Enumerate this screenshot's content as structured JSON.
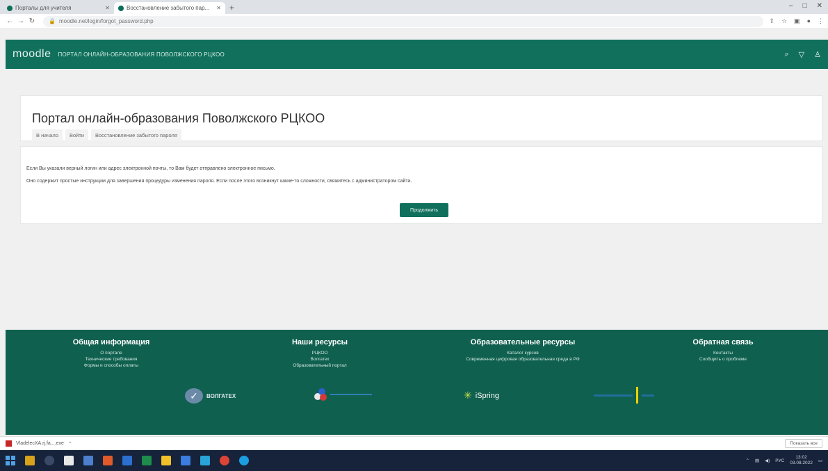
{
  "browser": {
    "tabs": [
      {
        "title": "Порталы для учителя"
      },
      {
        "title": "Восстановление забытого пар..."
      }
    ],
    "new_tab": "+",
    "url": "moodle.net/login/forgot_password.php",
    "window_controls": {
      "minimize": "–",
      "maximize": "□",
      "close": "✕"
    }
  },
  "site": {
    "logo": "moodle",
    "portal_name": "ПОРТАЛ ОНЛАЙН-ОБРАЗОВАНИЯ ПОВОЛЖСКОГО РЦКОО"
  },
  "page": {
    "title": "Портал онлайн-образования Поволжского РЦКОО",
    "breadcrumb": [
      "В начало",
      "Войти",
      "Восстановление забытого пароля"
    ]
  },
  "content": {
    "message1": "Если Вы указали верный логин или адрес электронной почты, то Вам будет отправлено электронное письмо.",
    "message2": "Оно содержит простые инструкции для завершения процедуры изменения пароля. Если после этого возникнут какие-то сложности, свяжитесь с администратором сайта.",
    "continue_label": "Продолжить"
  },
  "footer": {
    "columns": [
      {
        "title": "Общая информация",
        "links": [
          "О портале",
          "Технические требования",
          "Формы и способы оплаты"
        ]
      },
      {
        "title": "Наши ресурсы",
        "links": [
          "РЦКОО",
          "Волгатех",
          "Образовательный портал"
        ]
      },
      {
        "title": "Образовательные ресурсы",
        "links": [
          "Каталог курсов",
          "Современная цифровая образовательная среда в РФ"
        ]
      },
      {
        "title": "Обратная связь",
        "links": [
          "Контакты",
          "Сообщить о проблеме"
        ]
      }
    ],
    "partners": {
      "volgatech": "ВОЛГАТЕХ",
      "ispring": "iSpring"
    }
  },
  "downloads": {
    "file": "VladelecXA.rj.fa....exe",
    "show_all": "Показать все"
  },
  "taskbar": {
    "lang": "РУС",
    "time": "13:02",
    "date": "03.08.2022"
  },
  "colors": {
    "brand": "#10705c",
    "footer": "#10604f"
  }
}
